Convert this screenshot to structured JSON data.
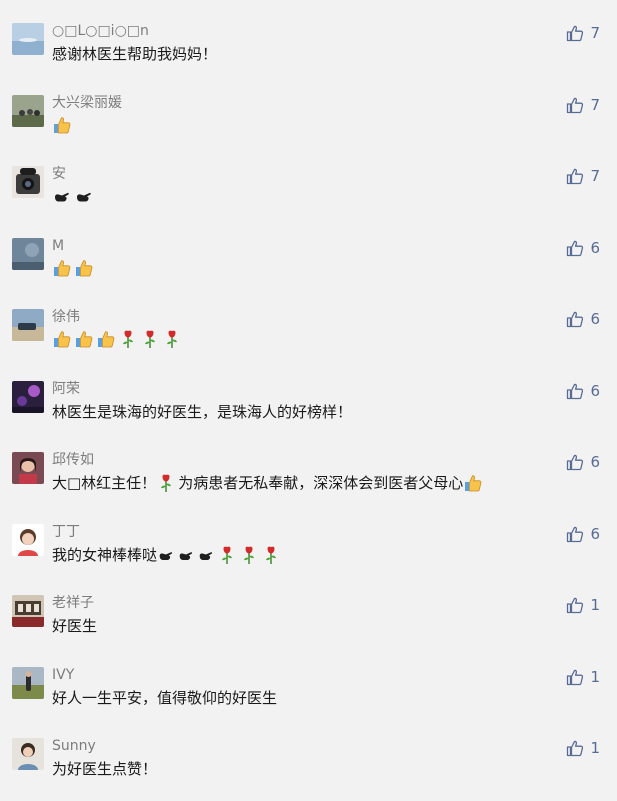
{
  "comments": [
    {
      "name": "○□L○□i○□n",
      "text": "感谢林医生帮助我妈妈！",
      "likes": "7",
      "avatar": "landscape-sky-avatar",
      "emojis_before": [],
      "emojis_after": []
    },
    {
      "name": "大兴梁丽媛",
      "text": "",
      "likes": "7",
      "avatar": "outdoor-group-avatar",
      "emojis_before": [
        "thumbs-up-icon"
      ],
      "emojis_after": []
    },
    {
      "name": "安",
      "text": "",
      "likes": "7",
      "avatar": "camera-person-avatar",
      "emojis_before": [
        "pointing-hand-icon",
        "pointing-hand-icon"
      ],
      "emojis_after": []
    },
    {
      "name": "M",
      "text": "",
      "likes": "6",
      "avatar": "blue-gray-avatar",
      "emojis_before": [
        "thumbs-up-icon",
        "thumbs-up-icon"
      ],
      "emojis_after": []
    },
    {
      "name": "徐伟",
      "text": "",
      "likes": "6",
      "avatar": "beach-car-avatar",
      "emojis_before": [
        "thumbs-up-icon",
        "thumbs-up-icon",
        "thumbs-up-icon",
        "rose-icon",
        "rose-icon",
        "rose-icon"
      ],
      "emojis_after": []
    },
    {
      "name": "阿荣",
      "text": "林医生是珠海的好医生，是珠海人的好榜样！",
      "likes": "6",
      "avatar": "purple-night-avatar",
      "emojis_before": [],
      "emojis_after": []
    },
    {
      "name": "邱传如",
      "text": "大□林红主任！",
      "text2": "为病患者无私奉献，深深体会到医者父母心",
      "likes": "6",
      "avatar": "woman-portrait-avatar",
      "emojis_before": [],
      "emojis_after": []
    },
    {
      "name": "丁丁",
      "text": "我的女神棒棒哒",
      "likes": "6",
      "avatar": "cartoon-girl-avatar",
      "emojis_before": [],
      "emojis_after": [
        "pointing-hand-icon",
        "pointing-hand-icon",
        "pointing-hand-icon",
        "rose-icon",
        "rose-icon",
        "rose-icon"
      ]
    },
    {
      "name": "老祥子",
      "text": "好医生",
      "likes": "1",
      "avatar": "room-scene-avatar",
      "emojis_before": [],
      "emojis_after": []
    },
    {
      "name": "IVY",
      "text": "好人一生平安，值得敬仰的好医生",
      "likes": "1",
      "avatar": "field-person-avatar",
      "emojis_before": [],
      "emojis_after": []
    },
    {
      "name": "Sunny",
      "text": "为好医生点赞！",
      "likes": "1",
      "avatar": "child-photo-avatar",
      "emojis_before": [],
      "emojis_after": []
    }
  ],
  "colors": {
    "like": "#576b95",
    "name": "#7d7d7d",
    "text": "#1a1a1a",
    "background": "#f2f2f2"
  }
}
